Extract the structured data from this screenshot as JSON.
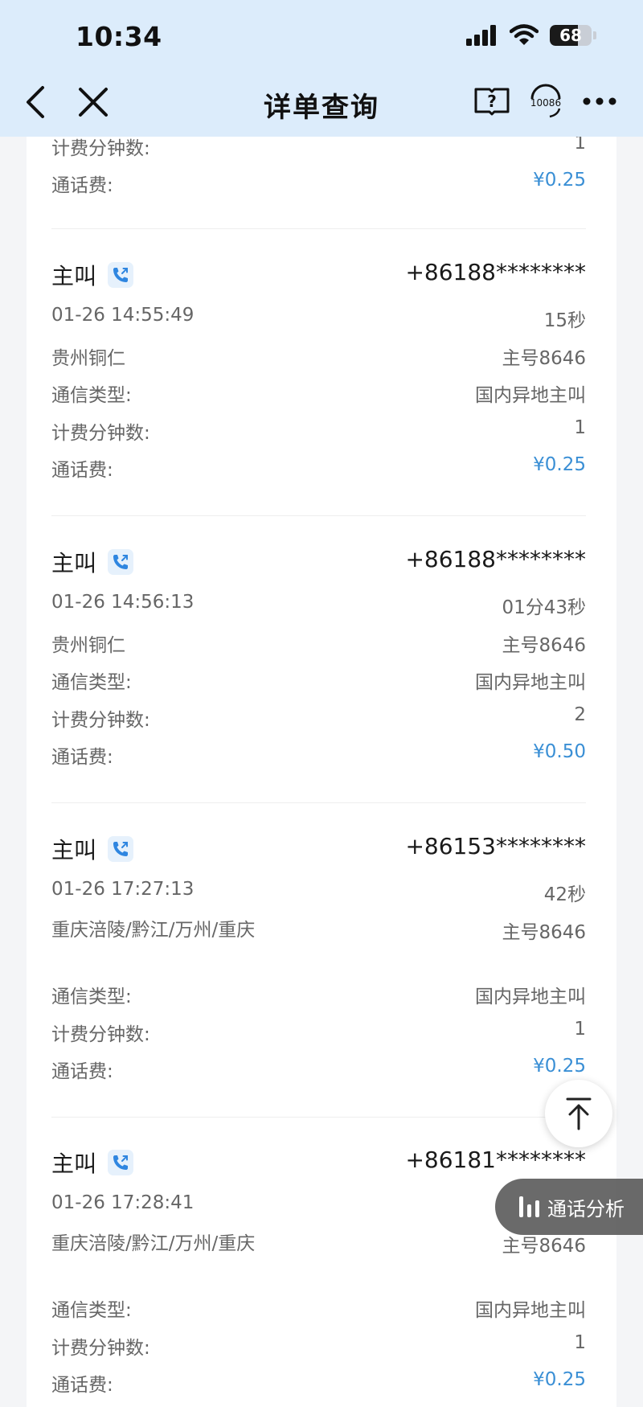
{
  "status_bar": {
    "time": "10:34",
    "battery_percent": "68",
    "battery_level": 0.68
  },
  "nav": {
    "title": "详单查询",
    "service_label": "10086"
  },
  "labels": {
    "comm_type": "通信类型:",
    "billing_minutes": "计费分钟数:",
    "call_fee": "通话费:"
  },
  "partial_record": {
    "billing_minutes": "1",
    "fee": "¥0.25"
  },
  "records": [
    {
      "direction": "主叫",
      "number": "+86188********",
      "datetime": "01-26 14:55:49",
      "duration": "15秒",
      "location": "贵州铜仁",
      "line": "主号8646",
      "comm_type": "国内异地主叫",
      "billing_minutes": "1",
      "fee": "¥0.25"
    },
    {
      "direction": "主叫",
      "number": "+86188********",
      "datetime": "01-26 14:56:13",
      "duration": "01分43秒",
      "location": "贵州铜仁",
      "line": "主号8646",
      "comm_type": "国内异地主叫",
      "billing_minutes": "2",
      "fee": "¥0.50"
    },
    {
      "direction": "主叫",
      "number": "+86153********",
      "datetime": "01-26 17:27:13",
      "duration": "42秒",
      "location": "重庆涪陵/黔江/万州/重庆",
      "line": "主号8646",
      "comm_type": "国内异地主叫",
      "billing_minutes": "1",
      "fee": "¥0.25"
    },
    {
      "direction": "主叫",
      "number": "+86181********",
      "datetime": "01-26 17:28:41",
      "duration": "",
      "location": "重庆涪陵/黔江/万州/重庆",
      "line": "主号8646",
      "comm_type": "国内异地主叫",
      "billing_minutes": "1",
      "fee": "¥0.25"
    }
  ],
  "floating": {
    "analysis_label": "通话分析"
  }
}
